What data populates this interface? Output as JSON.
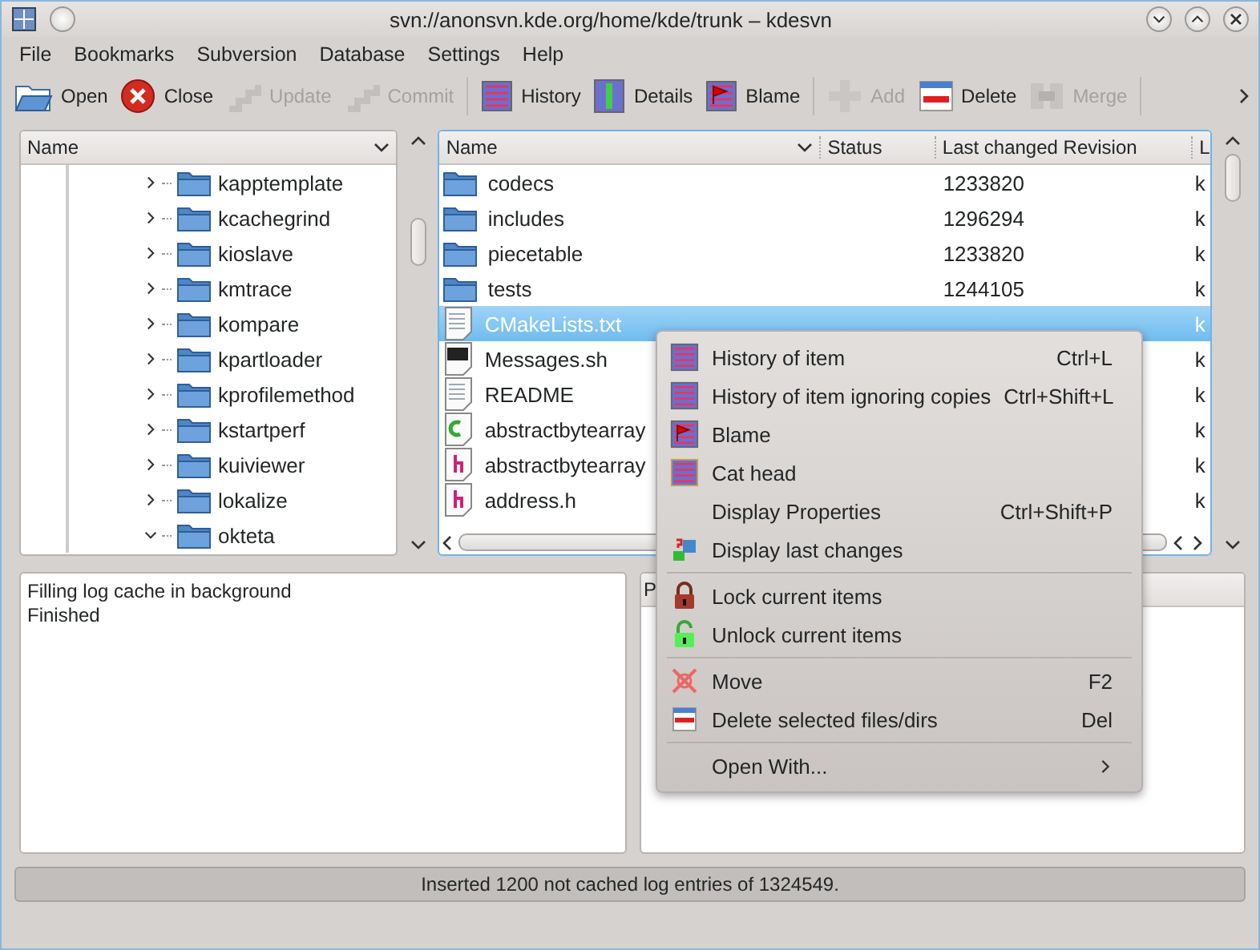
{
  "window": {
    "title": "svn://anonsvn.kde.org/home/kde/trunk – kdesvn"
  },
  "menubar": [
    {
      "label": "File"
    },
    {
      "label": "Bookmarks"
    },
    {
      "label": "Subversion"
    },
    {
      "label": "Database"
    },
    {
      "label": "Settings"
    },
    {
      "label": "Help"
    }
  ],
  "toolbar": [
    [
      {
        "label": "Open",
        "disabled": false
      },
      {
        "label": "Close",
        "disabled": false
      },
      {
        "label": "Update",
        "disabled": true
      },
      {
        "label": "Commit",
        "disabled": true
      }
    ],
    [
      {
        "label": "History",
        "disabled": false
      },
      {
        "label": "Details",
        "disabled": false
      },
      {
        "label": "Blame",
        "disabled": false
      }
    ],
    [
      {
        "label": "Add",
        "disabled": true
      },
      {
        "label": "Delete",
        "disabled": false
      },
      {
        "label": "Merge",
        "disabled": true
      }
    ]
  ],
  "tree": {
    "header": "Name",
    "items": [
      {
        "label": "kapptemplate",
        "expanded": false
      },
      {
        "label": "kcachegrind",
        "expanded": false
      },
      {
        "label": "kioslave",
        "expanded": false
      },
      {
        "label": "kmtrace",
        "expanded": false
      },
      {
        "label": "kompare",
        "expanded": false
      },
      {
        "label": "kpartloader",
        "expanded": false
      },
      {
        "label": "kprofilemethod",
        "expanded": false
      },
      {
        "label": "kstartperf",
        "expanded": false
      },
      {
        "label": "kuiviewer",
        "expanded": false
      },
      {
        "label": "lokalize",
        "expanded": false
      },
      {
        "label": "okteta",
        "expanded": true
      }
    ]
  },
  "files": {
    "columns": [
      "Name",
      "Status",
      "Last changed Revision",
      "L"
    ],
    "rows": [
      {
        "kind": "folder",
        "name": "codecs",
        "revision": "1233820",
        "column_4": "k",
        "selected": false
      },
      {
        "kind": "folder",
        "name": "includes",
        "revision": "1296294",
        "column_4": "k",
        "selected": false
      },
      {
        "kind": "folder",
        "name": "piecetable",
        "revision": "1233820",
        "column_4": "k",
        "selected": false
      },
      {
        "kind": "folder",
        "name": "tests",
        "revision": "1244105",
        "column_4": "k",
        "selected": false
      },
      {
        "kind": "text",
        "name": "CMakeLists.txt",
        "column_4": "k",
        "selected": true
      },
      {
        "kind": "script",
        "name": "Messages.sh",
        "column_4": "k",
        "selected": false
      },
      {
        "kind": "text",
        "name": "README",
        "column_4": "k",
        "selected": false
      },
      {
        "kind": "cpp",
        "name": "abstractbytearray",
        "column_4": "k",
        "selected": false
      },
      {
        "kind": "header",
        "name": "abstractbytearray",
        "column_4": "k",
        "selected": false
      },
      {
        "kind": "header",
        "name": "address.h",
        "column_4": "k",
        "selected": false
      }
    ]
  },
  "log": [
    "Filling log cache in background",
    "Finished"
  ],
  "details": {
    "header": "P"
  },
  "context_menu": [
    [
      {
        "label": "History of item",
        "shortcut": "Ctrl+L"
      },
      {
        "label": "History of item ignoring copies",
        "shortcut": "Ctrl+Shift+L"
      },
      {
        "label": "Blame"
      },
      {
        "label": "Cat head"
      },
      {
        "label": "Display Properties",
        "shortcut": "Ctrl+Shift+P"
      },
      {
        "label": "Display last changes"
      }
    ],
    [
      {
        "label": "Lock current items"
      },
      {
        "label": "Unlock current items"
      }
    ],
    [
      {
        "label": "Move",
        "shortcut": "F2"
      },
      {
        "label": "Delete selected files/dirs",
        "shortcut": "Del"
      }
    ],
    [
      {
        "label": "Open With...",
        "submenu": true
      }
    ]
  ],
  "status_bar": "Inserted 1200 not cached log entries of 1324549."
}
